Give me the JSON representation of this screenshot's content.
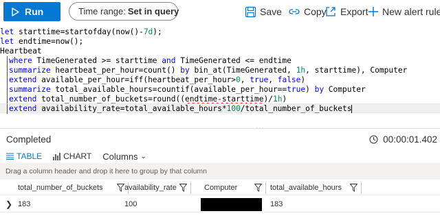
{
  "toolbar": {
    "run_label": "Run",
    "time_range_prefix": "Time range:",
    "time_range_value": "Set in query",
    "save_label": "Save",
    "copy_label": "Copy",
    "export_label": "Export",
    "new_alert_label": "New alert rule",
    "accent_color": "#0078d4"
  },
  "editor": {
    "lines": [
      {
        "p1": "let ",
        "p2": "starttime=startofday(now()-",
        "num": "7d",
        "p3": ");"
      },
      {
        "p1": "let ",
        "p2": "endtime=now();"
      },
      {
        "p1": "Heartbeat"
      },
      {
        "kw": "where",
        "p2": " TimeGenerated >= starttime ",
        "kw2": "and",
        "p3": " TimeGenerated <= endtime"
      },
      {
        "kw": "summarize",
        "p2": " heartbeat_per_hour=count() ",
        "kw2": "by",
        "p3": " bin_at(TimeGenerated, ",
        "num": "1h",
        "p4": ", starttime), Computer"
      },
      {
        "kw": "extend",
        "p2": " available_per_hour=iff(heartbeat_per_hour>",
        "num": "0",
        "p3": ", ",
        "b1": "true",
        "p4": ", ",
        "b2": "false",
        "p5": ")"
      },
      {
        "kw": "summarize",
        "p2": " total_available_hours=countif(available_per_hour==",
        "b1": "true",
        "p3": ") ",
        "kw2": "by",
        "p4": " Computer"
      },
      {
        "kw": "extend",
        "p2": " total_number_of_buckets=round((",
        "sq": "endtime-starttime",
        "p3": ")/",
        "num": "1h",
        "p4": ")"
      },
      {
        "kw": "extend",
        "p2": " availability_rate=total_available_hours*",
        "num": "100",
        "p3": "/total_number_of_buckets"
      }
    ],
    "splitter_dots": "..."
  },
  "results": {
    "status": "Completed",
    "duration": "00:00:01.402",
    "tabs": {
      "table": "TABLE",
      "chart": "CHART",
      "columns": "Columns"
    },
    "group_hint": "Drag a column header and drop it here to group by that column",
    "columns": [
      "total_number_of_buckets",
      "availability_rate",
      "Computer",
      "total_available_hours"
    ],
    "rows": [
      {
        "total_number_of_buckets": "183",
        "availability_rate": "100",
        "Computer": "",
        "total_available_hours": "183"
      }
    ]
  }
}
